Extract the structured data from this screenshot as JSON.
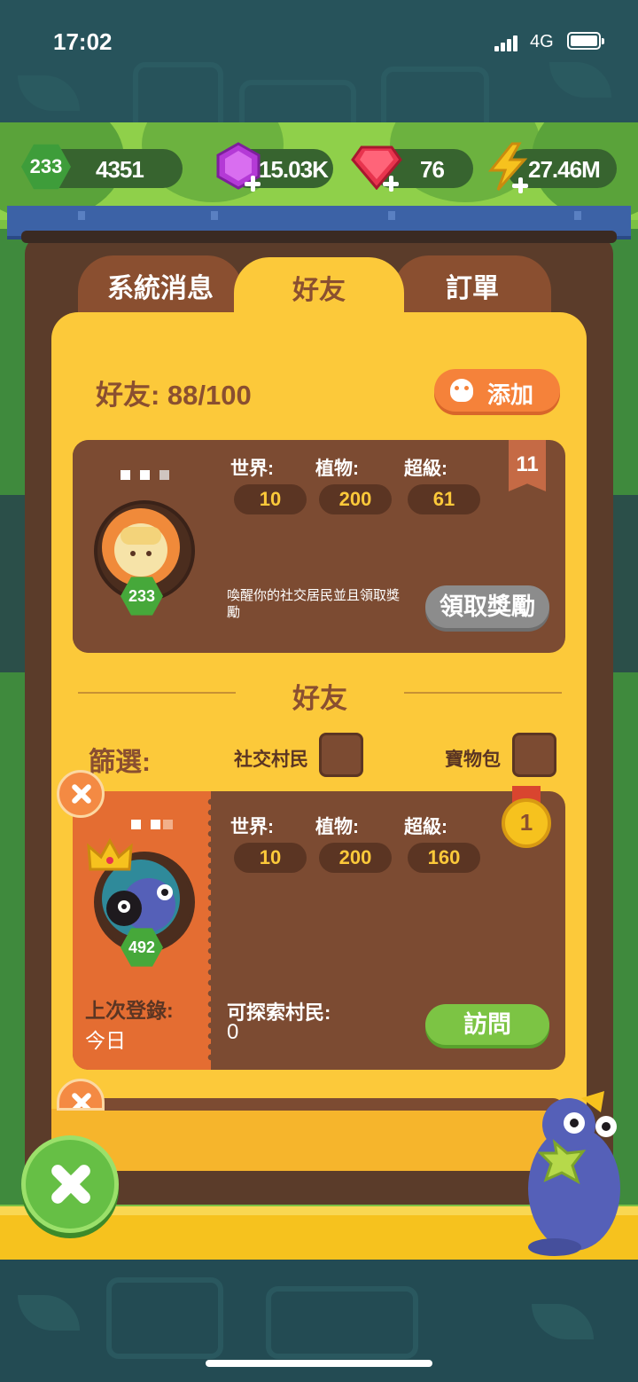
{
  "status_bar": {
    "time": "17:02",
    "network": "4G"
  },
  "resources": {
    "level": "233",
    "coins": "4351",
    "gems": "15.03K",
    "rubies": "76",
    "energy": "27.46M"
  },
  "tabs": [
    {
      "label": "系統消息",
      "active": false
    },
    {
      "label": "好友",
      "active": true
    },
    {
      "label": "訂單",
      "active": false
    }
  ],
  "friends_header": {
    "count_text": "好友: 88/100",
    "add_button": "添加"
  },
  "self_card": {
    "bookmark": "11",
    "level": "233",
    "stats": [
      {
        "label": "世界:",
        "value": "10"
      },
      {
        "label": "植物:",
        "value": "200"
      },
      {
        "label": "超級:",
        "value": "61"
      }
    ],
    "message": "喚醒你的社交居民並且領取獎勵",
    "claim_button": "領取獎勵"
  },
  "section_title": "好友",
  "filter": {
    "label": "篩選:",
    "options": [
      {
        "label": "社交村民"
      },
      {
        "label": "寶物包"
      }
    ]
  },
  "friend_card": {
    "rank": "1",
    "level": "492",
    "stats": [
      {
        "label": "世界:",
        "value": "10"
      },
      {
        "label": "植物:",
        "value": "200"
      },
      {
        "label": "超級:",
        "value": "160"
      }
    ],
    "last_login_label": "上次登錄:",
    "last_login_value": "今日",
    "explorable_label": "可探索村民:",
    "explorable_value": "0",
    "visit_button": "訪問"
  },
  "colors": {
    "panel": "#fcc93a",
    "card": "#7c4b32",
    "accent_orange": "#f5823a",
    "accent_green": "#7cc444"
  }
}
